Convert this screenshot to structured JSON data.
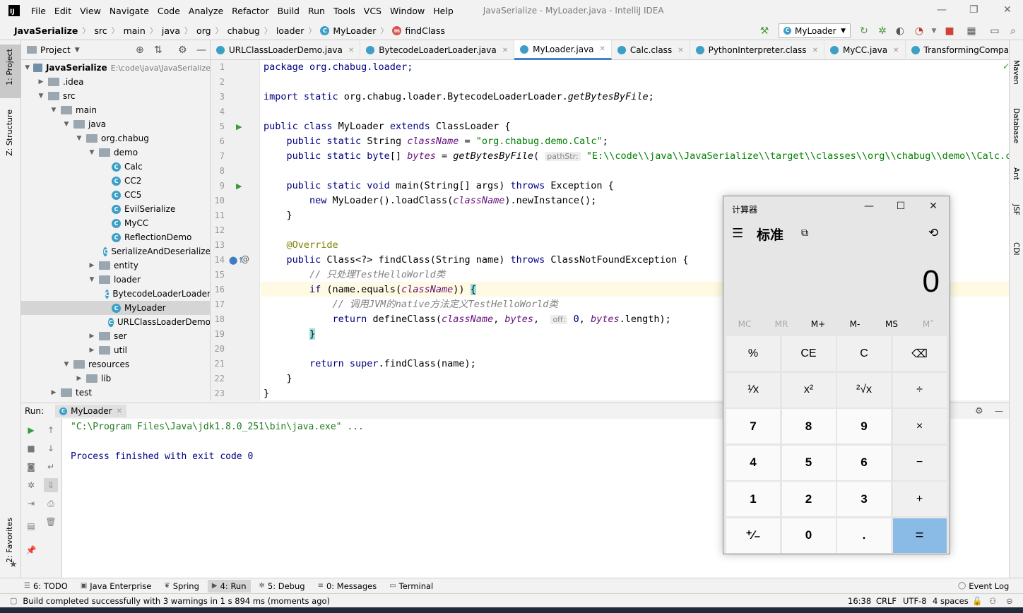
{
  "window": {
    "title": "JavaSerialize - MyLoader.java - IntelliJ IDEA",
    "logo": "IJ"
  },
  "menu": [
    "File",
    "Edit",
    "View",
    "Navigate",
    "Code",
    "Analyze",
    "Refactor",
    "Build",
    "Run",
    "Tools",
    "VCS",
    "Window",
    "Help"
  ],
  "breadcrumbs": [
    "JavaSerialize",
    "src",
    "main",
    "java",
    "org",
    "chabug",
    "loader",
    "MyLoader",
    "findClass"
  ],
  "run_config": "MyLoader",
  "left_strip": {
    "project": "1: Project",
    "structure": "Z: Structure",
    "favorites": "2: Favorites"
  },
  "right_strip": [
    "Maven",
    "Database",
    "Ant",
    "JSF",
    "CDI"
  ],
  "project_panel": {
    "title": "Project",
    "tree": [
      {
        "label": "JavaSerialize",
        "extra": "E:\\code\\java\\JavaSerialize",
        "indent": 0,
        "type": "module",
        "expanded": true
      },
      {
        "label": ".idea",
        "indent": 1,
        "type": "folder",
        "expanded": false
      },
      {
        "label": "src",
        "indent": 1,
        "type": "folder",
        "expanded": true
      },
      {
        "label": "main",
        "indent": 2,
        "type": "folder",
        "expanded": true
      },
      {
        "label": "java",
        "indent": 3,
        "type": "folder",
        "expanded": true
      },
      {
        "label": "org.chabug",
        "indent": 4,
        "type": "folder",
        "expanded": true
      },
      {
        "label": "demo",
        "indent": 5,
        "type": "folder",
        "expanded": true
      },
      {
        "label": "Calc",
        "indent": 6,
        "type": "class"
      },
      {
        "label": "CC2",
        "indent": 6,
        "type": "class"
      },
      {
        "label": "CC5",
        "indent": 6,
        "type": "class"
      },
      {
        "label": "EvilSerialize",
        "indent": 6,
        "type": "class"
      },
      {
        "label": "MyCC",
        "indent": 6,
        "type": "class"
      },
      {
        "label": "ReflectionDemo",
        "indent": 6,
        "type": "class"
      },
      {
        "label": "SerializeAndDeserialize",
        "indent": 6,
        "type": "class"
      },
      {
        "label": "entity",
        "indent": 5,
        "type": "folder",
        "expanded": false
      },
      {
        "label": "loader",
        "indent": 5,
        "type": "folder",
        "expanded": true
      },
      {
        "label": "BytecodeLoaderLoader",
        "indent": 6,
        "type": "class"
      },
      {
        "label": "MyLoader",
        "indent": 6,
        "type": "class",
        "selected": true
      },
      {
        "label": "URLClassLoaderDemo",
        "indent": 6,
        "type": "class"
      },
      {
        "label": "ser",
        "indent": 5,
        "type": "folder",
        "expanded": false
      },
      {
        "label": "util",
        "indent": 5,
        "type": "folder",
        "expanded": false
      },
      {
        "label": "resources",
        "indent": 3,
        "type": "folder",
        "expanded": true
      },
      {
        "label": "lib",
        "indent": 4,
        "type": "folder",
        "expanded": false
      },
      {
        "label": "test",
        "indent": 2,
        "type": "folder",
        "expanded": false
      }
    ]
  },
  "editor_tabs": [
    {
      "label": "URLClassLoaderDemo.java",
      "icon_color": "#3d9fc7"
    },
    {
      "label": "BytecodeLoaderLoader.java",
      "icon_color": "#3d9fc7"
    },
    {
      "label": "MyLoader.java",
      "icon_color": "#3d9fc7",
      "active": true
    },
    {
      "label": "Calc.class",
      "icon_color": "#3d9fc7"
    },
    {
      "label": "PythonInterpreter.class",
      "icon_color": "#3d9fc7"
    },
    {
      "label": "MyCC.java",
      "icon_color": "#3d9fc7"
    },
    {
      "label": "TransformingComparator.class",
      "icon_color": "#3d9fc7"
    }
  ],
  "code": {
    "line_numbers": [
      "1",
      "2",
      "3",
      "4",
      "5",
      "6",
      "7",
      "8",
      "9",
      "10",
      "11",
      "12",
      "13",
      "14",
      "15",
      "16",
      "17",
      "18",
      "19",
      "20",
      "21",
      "22",
      "23"
    ],
    "l1": "package org.chabug.loader;",
    "l3a": "import static ",
    "l3b": "org.chabug.loader.BytecodeLoaderLoader.",
    "l3c": "getBytesByFile",
    "l3d": ";",
    "l5a": "public class ",
    "l5b": "MyLoader ",
    "l5c": "extends ",
    "l5d": "ClassLoader {",
    "l6a": "    public static ",
    "l6b": "String ",
    "l6c": "className",
    "l6d": " = ",
    "l6e": "\"org.chabug.demo.Calc\"",
    "l6f": ";",
    "l7a": "    public static byte",
    "l7b": "[] ",
    "l7c": "bytes",
    "l7d": " = ",
    "l7e": "getBytesByFile",
    "l7f": "( ",
    "l7hint": "pathStr:",
    "l7g": " \"E:\\\\code\\\\java\\\\JavaSerialize\\\\target\\\\classes\\\\org\\\\chabug\\\\demo\\\\Calc.class\");",
    "l9a": "    public static void ",
    "l9b": "main(String[] args) ",
    "l9c": "throws ",
    "l9d": "Exception {",
    "l10a": "        new ",
    "l10b": "MyLoader().loadClass(",
    "l10c": "className",
    "l10d": ").newInstance();",
    "l11": "    }",
    "l13": "    @Override",
    "l14a": "    public ",
    "l14b": "Class<?> findClass(String name) ",
    "l14c": "throws ",
    "l14d": "ClassNotFoundException {",
    "l15": "        // 只处理TestHelloWorld类",
    "l16a": "        if ",
    "l16b": "(name.equals(",
    "l16c": "className",
    "l16d": ")) ",
    "l16e": "{",
    "l17": "            // 调用JVM的native方法定义TestHelloWorld类",
    "l18a": "            return ",
    "l18b": "defineClass(",
    "l18c": "className",
    "l18d": ", ",
    "l18e": "bytes",
    "l18f": ",  ",
    "l18hint": "off:",
    "l18g": " 0",
    "l18h": ", ",
    "l18i": "bytes",
    "l18j": ".length);",
    "l19a": "        ",
    "l19b": "}",
    "l21a": "        return super",
    "l21b": ".findClass(name);",
    "l22": "    }",
    "l23": "}"
  },
  "run_panel": {
    "label": "Run:",
    "tab": "MyLoader",
    "cmd": "\"C:\\Program Files\\Java\\jdk1.8.0_251\\bin\\java.exe\" ...",
    "exit": "Process finished with exit code 0"
  },
  "bottom_tabs": [
    {
      "label": "6: TODO",
      "icon": "☰"
    },
    {
      "label": "Java Enterprise",
      "icon": "▣"
    },
    {
      "label": "Spring",
      "icon": "❦"
    },
    {
      "label": "4: Run",
      "icon": "▶",
      "active": true
    },
    {
      "label": "5: Debug",
      "icon": "✲"
    },
    {
      "label": "0: Messages",
      "icon": "≡"
    },
    {
      "label": "Terminal",
      "icon": "▭"
    }
  ],
  "event_log": "Event Log",
  "status": {
    "message": "Build completed successfully with 3 warnings in 1 s 894 ms (moments ago)",
    "position": "16:38",
    "line_sep": "CRLF",
    "encoding": "UTF-8",
    "indent": "4 spaces"
  },
  "calculator": {
    "title": "计算器",
    "mode": "标准",
    "display": "0",
    "memory": [
      "MC",
      "MR",
      "M+",
      "M-",
      "MS",
      "M˅"
    ],
    "memory_enabled": [
      false,
      false,
      true,
      true,
      true,
      false
    ],
    "keys": [
      "%",
      "CE",
      "C",
      "⌫",
      "¹⁄x",
      "x²",
      "²√x",
      "÷",
      "7",
      "8",
      "9",
      "×",
      "4",
      "5",
      "6",
      "−",
      "1",
      "2",
      "3",
      "+",
      "⁺⁄₋",
      "0",
      ".",
      "="
    ],
    "accent_color": "#8abbe6"
  }
}
